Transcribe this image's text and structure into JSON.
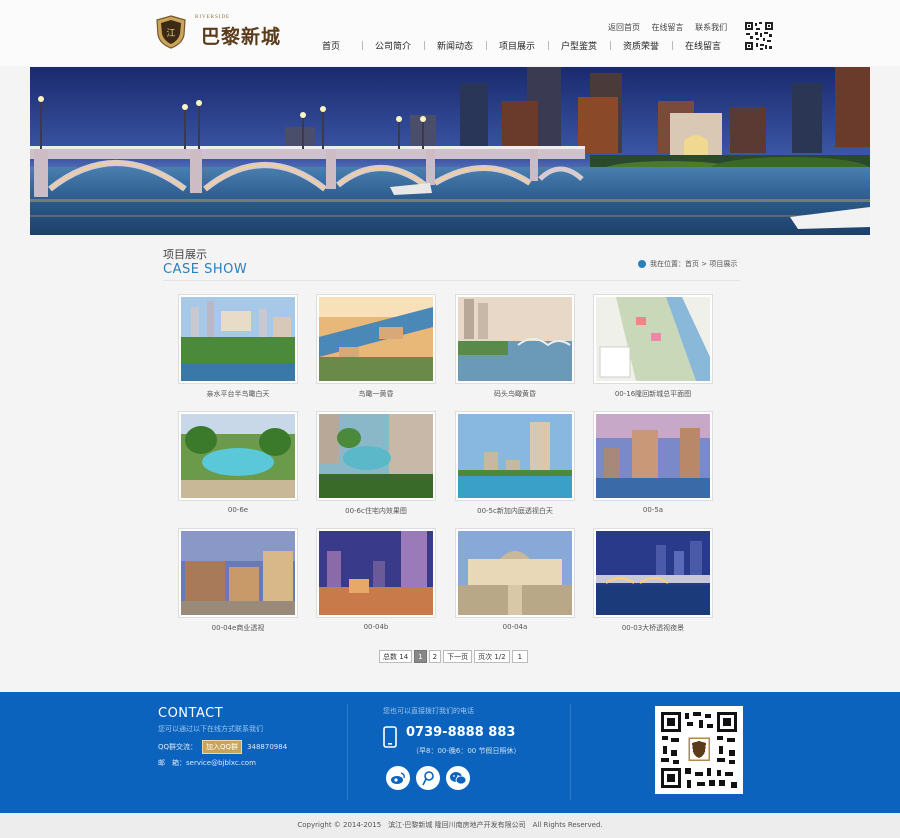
{
  "header": {
    "logo_cn": "巴黎新城",
    "logo_en": "RIVERSIDE",
    "top_links": [
      "返回首页",
      "在线留言",
      "联系我们"
    ],
    "nav": [
      "首页",
      "公司简介",
      "新闻动态",
      "项目展示",
      "户型鉴赏",
      "资质荣誉",
      "在线留言"
    ]
  },
  "section": {
    "title_cn": "项目展示",
    "title_en": "CASE SHOW",
    "breadcrumb": "我在位置：首页 > 项目展示"
  },
  "projects": [
    {
      "caption": "亲水平台半鸟瞰白天"
    },
    {
      "caption": "鸟瞰一黄昏"
    },
    {
      "caption": "码头鸟瞰黄昏"
    },
    {
      "caption": "00-16隆回新城总平面图"
    },
    {
      "caption": "00-6e"
    },
    {
      "caption": "00-6c住宅内效果图"
    },
    {
      "caption": "00-5c新加内庭透视白天"
    },
    {
      "caption": "00-5a"
    },
    {
      "caption": "00-04e商业透视"
    },
    {
      "caption": "00-04b"
    },
    {
      "caption": "00-04a"
    },
    {
      "caption": "00-03大桥透视夜景"
    }
  ],
  "pager": {
    "total_label": "总数",
    "total": "14",
    "pages": [
      "1",
      "2"
    ],
    "next": "下一页",
    "page_info": "页次 1/2",
    "jump": "1"
  },
  "footer": {
    "contact_title": "CONTACT",
    "contact_sub": "您可以通过以下在线方式联系我们",
    "qq_label": "QQ群交流：",
    "qq_button": "加入QQ群",
    "qq_number": "348870984",
    "email_label": "邮　箱：",
    "email": "service@bjblxc.com",
    "phone_sub": "您也可以直接拨打我们的电话",
    "phone": "0739-8888 883",
    "hours": "（早8：00-晚6：00 节假日照休）"
  },
  "copyright": "Copyright © 2014-2015　滨江·巴黎新城 隆回川南房地产开发有限公司　All Rights Reserved.",
  "colors": {
    "brand": "#0b63bd",
    "accent": "#2a7fbd",
    "logo": "#5a3b1a"
  },
  "icons": [
    "shield-logo-icon",
    "qr-code-icon",
    "location-dot-icon",
    "phone-icon",
    "weibo-icon",
    "tencent-weibo-icon",
    "wechat-icon"
  ]
}
